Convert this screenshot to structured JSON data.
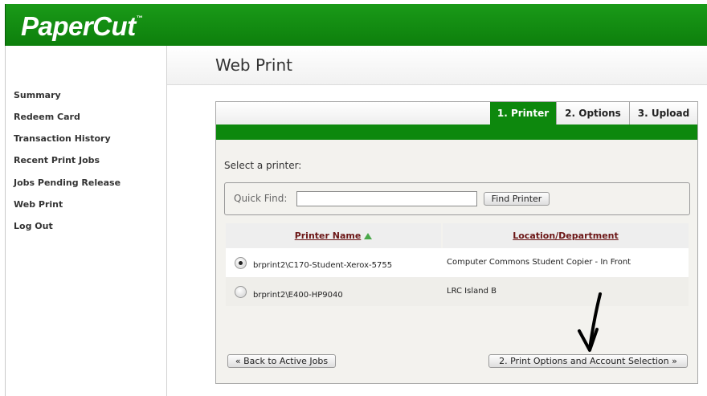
{
  "brand": {
    "logo": "PaperCut",
    "trademark": "™"
  },
  "sidebar": {
    "items": [
      {
        "label": "Summary"
      },
      {
        "label": "Redeem Card"
      },
      {
        "label": "Transaction History"
      },
      {
        "label": "Recent Print Jobs"
      },
      {
        "label": "Jobs Pending Release"
      },
      {
        "label": "Web Print"
      },
      {
        "label": "Log Out"
      }
    ]
  },
  "page": {
    "title": "Web Print"
  },
  "wizard": {
    "tabs": [
      {
        "label": "1. Printer",
        "active": true
      },
      {
        "label": "2. Options",
        "active": false
      },
      {
        "label": "3. Upload",
        "active": false
      }
    ],
    "select_label": "Select a printer:",
    "quick_find": {
      "label": "Quick Find:",
      "value": "",
      "button": "Find Printer"
    },
    "table": {
      "headers": [
        "Printer Name",
        "Location/Department"
      ],
      "rows": [
        {
          "name": "brprint2\\C170-Student-Xerox-5755",
          "location": "Computer Commons Student Copier - In Front",
          "selected": true
        },
        {
          "name": "brprint2\\E400-HP9040",
          "location": "LRC Island B",
          "selected": false
        }
      ]
    },
    "back_button": "« Back to Active Jobs",
    "next_button": "2. Print Options and Account Selection »"
  },
  "colors": {
    "brand_green": "#0d880d",
    "header_link": "#6b1515"
  },
  "icons": [
    "radio-selected-icon",
    "radio-unselected-icon",
    "sort-ascending-icon",
    "arrow-annotation-icon"
  ]
}
